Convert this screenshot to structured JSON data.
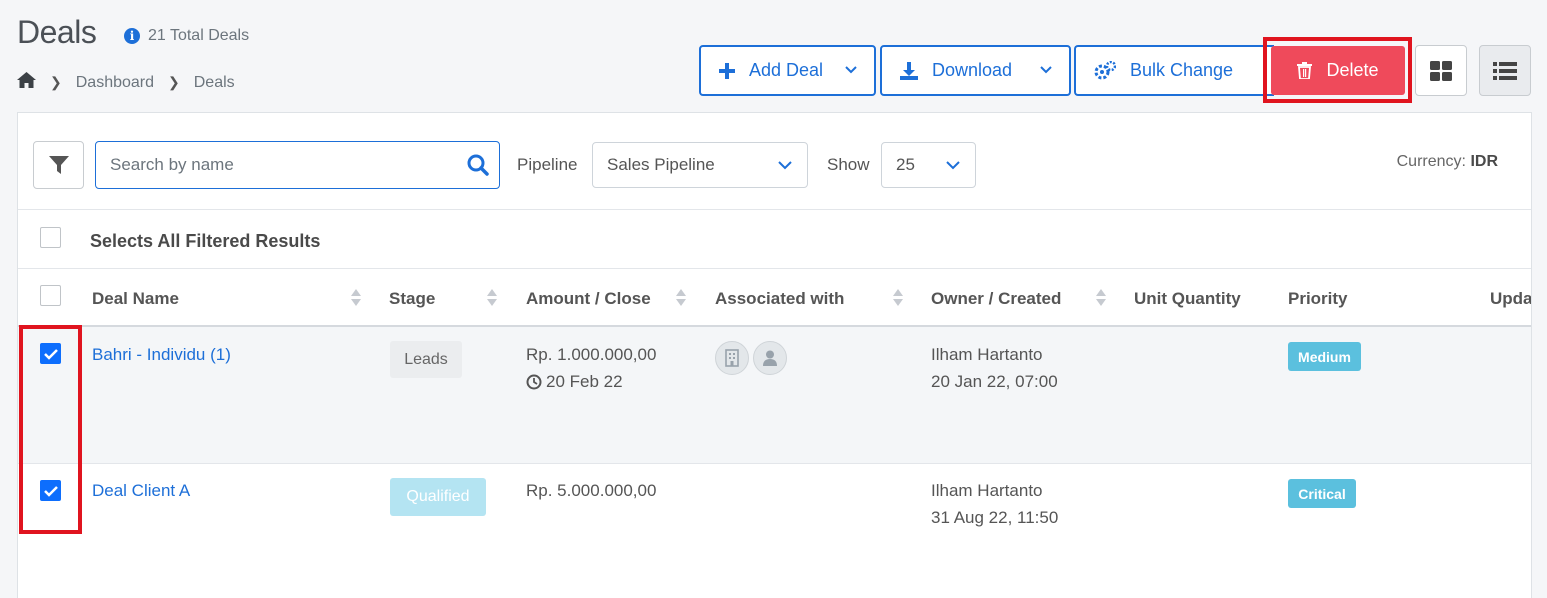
{
  "header": {
    "title": "Deals",
    "total_deals": "21 Total Deals",
    "info_icon": "info-circle-icon"
  },
  "breadcrumb": {
    "home_icon": "home-icon",
    "items": [
      "Dashboard",
      "Deals"
    ]
  },
  "toolbar": {
    "add_deal": "Add Deal",
    "download": "Download",
    "bulk_change": "Bulk Change",
    "delete": "Delete",
    "grid_view_icon": "grid-icon",
    "list_view_icon": "list-icon",
    "delete_color": "#ef4a5b",
    "accent_color": "#1d6fd8"
  },
  "filters": {
    "search_placeholder": "Search by name",
    "search_value": "",
    "pipeline_label": "Pipeline",
    "pipeline_value": "Sales Pipeline",
    "show_label": "Show",
    "show_value": "25",
    "currency_label": "Currency:",
    "currency_value": "IDR"
  },
  "table": {
    "select_all_label": "Selects All Filtered Results",
    "columns": [
      "Deal Name",
      "Stage",
      "Amount / Close",
      "Associated with",
      "Owner / Created",
      "Unit Quantity",
      "Priority",
      "Upda"
    ],
    "rows": [
      {
        "checked": true,
        "deal_name": "Bahri - Individu (1)",
        "stage": "Leads",
        "amount": "Rp. 1.000.000,00",
        "close_date": "20 Feb 22",
        "associated": [
          "company-icon",
          "person-icon"
        ],
        "owner": "Ilham Hartanto",
        "created": "20 Jan 22, 07:00",
        "unit_quantity": "",
        "priority": "Medium"
      },
      {
        "checked": true,
        "deal_name": "Deal Client A",
        "stage": "Qualified",
        "amount": "Rp. 5.000.000,00",
        "close_date": "",
        "associated": [],
        "owner": "Ilham Hartanto",
        "created": "31 Aug 22, 11:50",
        "unit_quantity": "",
        "priority": "Critical"
      }
    ]
  }
}
